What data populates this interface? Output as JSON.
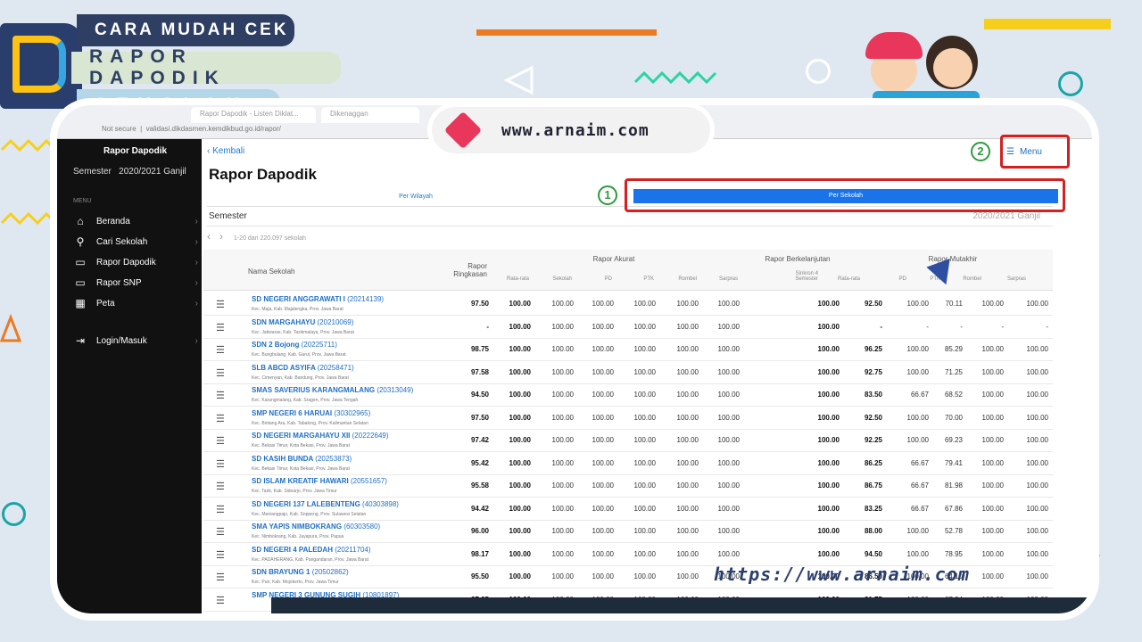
{
  "banner": {
    "line1": "CARA MUDAH CEK",
    "line2": "RAPOR DAPODIK",
    "line3": "SEKOLAH"
  },
  "site_pill": "www.arnaim.com",
  "footer_url": "https://www.arnaim.com",
  "browser": {
    "tab1": "Rapor Dapodik - Listen Diklat...",
    "tab2": "Dikenaggan",
    "url_prefix": "Not secure",
    "url": "validasi.dikdasmen.kemdikbud.go.id/rapor/"
  },
  "sidebar": {
    "title": "Rapor Dapodik",
    "semester_label": "Semester",
    "semester_value": "2020/2021 Ganjil",
    "menu_label": "MENU",
    "items": [
      {
        "label": "Beranda",
        "icon": "home-icon"
      },
      {
        "label": "Cari Sekolah",
        "icon": "search-icon"
      },
      {
        "label": "Rapor Dapodik",
        "icon": "book-icon"
      },
      {
        "label": "Rapor SNP",
        "icon": "book-icon"
      },
      {
        "label": "Peta",
        "icon": "map-icon"
      },
      {
        "label": "Login/Masuk",
        "icon": "login-icon"
      }
    ]
  },
  "main": {
    "back_label": "Kembali",
    "title": "Rapor Dapodik",
    "menu_label": "Menu",
    "tab_wilayah": "Per Wilayah",
    "tab_sekolah": "Per Sekolah",
    "semester_label": "Semester",
    "semester_value": "2020/2021 Ganjil",
    "pager_text": "1-20 dari 220.097 sekolah",
    "step1": "1",
    "step2": "2"
  },
  "table": {
    "col_name": "Nama Sekolah",
    "col_ringkasan": "Rapor Ringkasan",
    "group_akurat": "Rapor Akurat",
    "group_berkelanjutan": "Rapor Berkelanjutan",
    "group_mutakhir": "Rapor Mutakhir",
    "sub": [
      "Rata-rata",
      "Sekolah",
      "PD",
      "PTK",
      "Rombel",
      "Sarpras",
      "Sinkron 4 Semester",
      "Rata-rata",
      "PD",
      "PTK",
      "Rombel",
      "Sarpras"
    ],
    "rows": [
      {
        "name": "SD NEGERI ANGGRAWATI I",
        "npsn": "(20214139)",
        "addr": "Kec. Maja, Kab. Majalengka, Prov. Jawa Barat",
        "v": [
          "97.50",
          "100.00",
          "100.00",
          "100.00",
          "100.00",
          "100.00",
          "100.00",
          "100.00",
          "92.50",
          "100.00",
          "70.11",
          "100.00",
          "100.00"
        ]
      },
      {
        "name": "SDN MARGAHAYU",
        "npsn": "(20210069)",
        "addr": "Kec. Jatiwaras, Kab. Tasikmalaya, Prov. Jawa Barat",
        "v": [
          "-",
          "100.00",
          "100.00",
          "100.00",
          "100.00",
          "100.00",
          "100.00",
          "100.00",
          "-",
          "-",
          "-",
          "-",
          "-"
        ]
      },
      {
        "name": "SDN 2 Bojong",
        "npsn": "(20225711)",
        "addr": "Kec. Bungbulang, Kab. Garut, Prov. Jawa Barat",
        "v": [
          "98.75",
          "100.00",
          "100.00",
          "100.00",
          "100.00",
          "100.00",
          "100.00",
          "100.00",
          "96.25",
          "100.00",
          "85.29",
          "100.00",
          "100.00"
        ]
      },
      {
        "name": "SLB ABCD ASYIFA",
        "npsn": "(20258471)",
        "addr": "Kec. Cimenyan, Kab. Bandung, Prov. Jawa Barat",
        "v": [
          "97.58",
          "100.00",
          "100.00",
          "100.00",
          "100.00",
          "100.00",
          "100.00",
          "100.00",
          "92.75",
          "100.00",
          "71.25",
          "100.00",
          "100.00"
        ]
      },
      {
        "name": "SMAS SAVERIUS KARANGMALANG",
        "npsn": "(20313049)",
        "addr": "Kec. Karangmalang, Kab. Sragen, Prov. Jawa Tengah",
        "v": [
          "94.50",
          "100.00",
          "100.00",
          "100.00",
          "100.00",
          "100.00",
          "100.00",
          "100.00",
          "83.50",
          "66.67",
          "68.52",
          "100.00",
          "100.00"
        ]
      },
      {
        "name": "SMP NEGERI 6 HARUAI",
        "npsn": "(30302965)",
        "addr": "Kec. Bintang Ara, Kab. Tabalong, Prov. Kalimantan Selatan",
        "v": [
          "97.50",
          "100.00",
          "100.00",
          "100.00",
          "100.00",
          "100.00",
          "100.00",
          "100.00",
          "92.50",
          "100.00",
          "70.00",
          "100.00",
          "100.00"
        ]
      },
      {
        "name": "SD NEGERI MARGAHAYU XII",
        "npsn": "(20222649)",
        "addr": "Kec. Bekasi Timur, Kota Bekasi, Prov. Jawa Barat",
        "v": [
          "97.42",
          "100.00",
          "100.00",
          "100.00",
          "100.00",
          "100.00",
          "100.00",
          "100.00",
          "92.25",
          "100.00",
          "69.23",
          "100.00",
          "100.00"
        ]
      },
      {
        "name": "SD KASIH BUNDA",
        "npsn": "(20253873)",
        "addr": "Kec. Bekasi Timur, Kota Bekasi, Prov. Jawa Barat",
        "v": [
          "95.42",
          "100.00",
          "100.00",
          "100.00",
          "100.00",
          "100.00",
          "100.00",
          "100.00",
          "86.25",
          "66.67",
          "79.41",
          "100.00",
          "100.00"
        ]
      },
      {
        "name": "SD ISLAM KREATIF HAWARI",
        "npsn": "(20551657)",
        "addr": "Kec. Tarik, Kab. Sidoarjo, Prov. Jawa Timur",
        "v": [
          "95.58",
          "100.00",
          "100.00",
          "100.00",
          "100.00",
          "100.00",
          "100.00",
          "100.00",
          "86.75",
          "66.67",
          "81.98",
          "100.00",
          "100.00"
        ]
      },
      {
        "name": "SD NEGERI 137 LALEBENTENG",
        "npsn": "(40303898)",
        "addr": "Kec. Maniangpajo, Kab. Soppeng, Prov. Sulawesi Selatan",
        "v": [
          "94.42",
          "100.00",
          "100.00",
          "100.00",
          "100.00",
          "100.00",
          "100.00",
          "100.00",
          "83.25",
          "66.67",
          "67.86",
          "100.00",
          "100.00"
        ]
      },
      {
        "name": "SMA YAPIS NIMBOKRANG",
        "npsn": "(60303580)",
        "addr": "Kec. Nimbokrang, Kab. Jayapura, Prov. Papua",
        "v": [
          "96.00",
          "100.00",
          "100.00",
          "100.00",
          "100.00",
          "100.00",
          "100.00",
          "100.00",
          "88.00",
          "100.00",
          "52.78",
          "100.00",
          "100.00"
        ]
      },
      {
        "name": "SD NEGERI 4 PALEDAH",
        "npsn": "(20211704)",
        "addr": "Kec. PADAHERANG, Kab. Pangandaran, Prov. Jawa Barat",
        "v": [
          "98.17",
          "100.00",
          "100.00",
          "100.00",
          "100.00",
          "100.00",
          "100.00",
          "100.00",
          "94.50",
          "100.00",
          "78.95",
          "100.00",
          "100.00"
        ]
      },
      {
        "name": "SDN BRAYUNG 1",
        "npsn": "(20502862)",
        "addr": "Kec. Puri, Kab. Mojokerto, Prov. Jawa Timur",
        "v": [
          "95.50",
          "100.00",
          "100.00",
          "100.00",
          "100.00",
          "100.00",
          "100.00",
          "100.00",
          "86.50",
          "100.00",
          "64.10",
          "100.00",
          "100.00"
        ]
      },
      {
        "name": "SMP NEGERI 3 GUNUNG SUGIH",
        "npsn": "(10801897)",
        "addr": "",
        "v": [
          "97.25",
          "100.00",
          "100.00",
          "100.00",
          "100.00",
          "100.00",
          "100.00",
          "100.00",
          "91.75",
          "100.00",
          "67.94",
          "100.00",
          "100.00"
        ]
      }
    ]
  },
  "colors": {
    "accent": "#1a73e8",
    "sidebar": "#111111",
    "highlight": "#d32020",
    "step": "#2e9a3e"
  }
}
